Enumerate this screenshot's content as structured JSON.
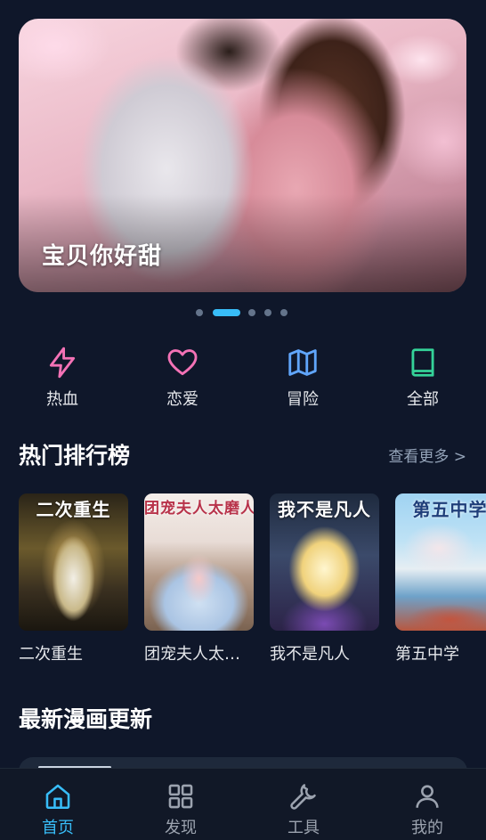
{
  "banner": {
    "title": "宝贝你好甜",
    "dots": 5,
    "active_dot": 1
  },
  "categories": [
    {
      "label": "热血",
      "icon": "lightning-icon",
      "color": "#f472b6"
    },
    {
      "label": "恋爱",
      "icon": "heart-icon",
      "color": "#f472b6"
    },
    {
      "label": "冒险",
      "icon": "map-icon",
      "color": "#60a5fa"
    },
    {
      "label": "全部",
      "icon": "book-icon",
      "color": "#34d399"
    }
  ],
  "hot": {
    "title": "热门排行榜",
    "more": "查看更多 >",
    "items": [
      {
        "title": "二次重生",
        "cover_text": "二次重生"
      },
      {
        "title": "团宠夫人太磨人",
        "cover_text": "团宠夫人太磨人"
      },
      {
        "title": "我不是凡人",
        "cover_text": "我不是凡人"
      },
      {
        "title": "第五中学",
        "cover_text": "第五中学"
      }
    ]
  },
  "latest": {
    "title": "最新漫画更新"
  },
  "nav": [
    {
      "label": "首页",
      "icon": "home-icon",
      "active": true
    },
    {
      "label": "发现",
      "icon": "grid-icon",
      "active": false
    },
    {
      "label": "工具",
      "icon": "wrench-icon",
      "active": false
    },
    {
      "label": "我的",
      "icon": "user-icon",
      "active": false
    }
  ],
  "colors": {
    "background": "#0f172a",
    "accent": "#38bdf8"
  }
}
